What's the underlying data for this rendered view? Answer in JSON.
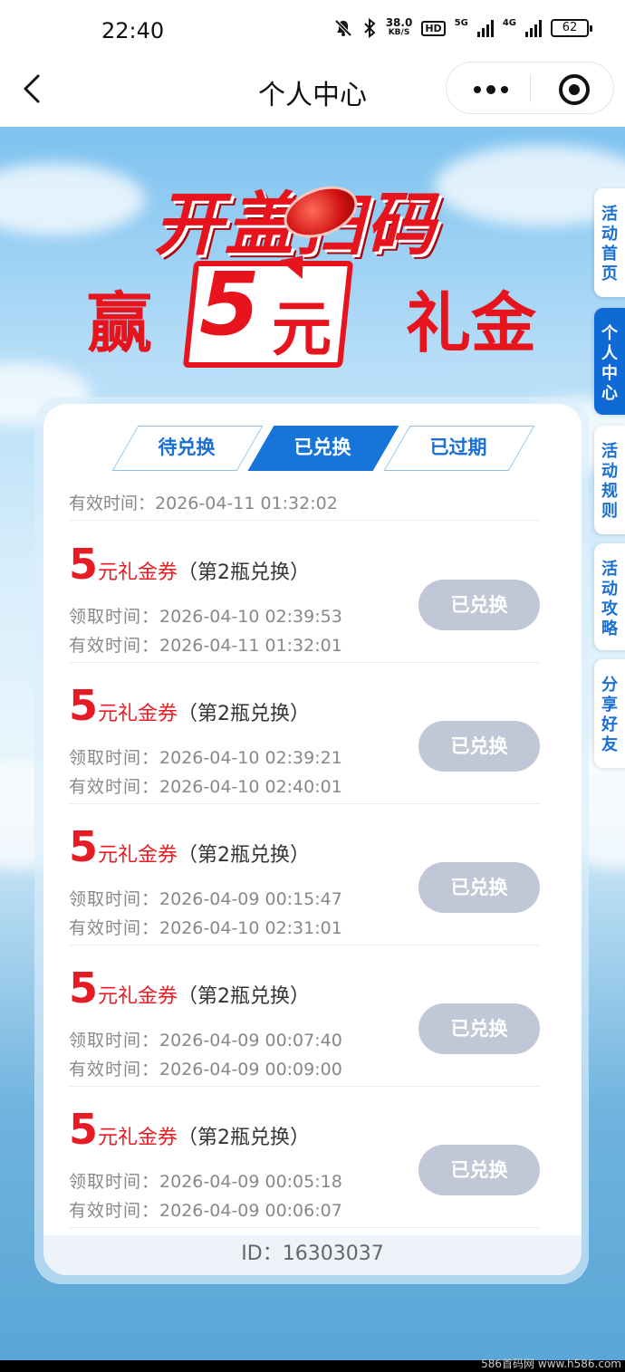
{
  "status_bar": {
    "time": "22:40",
    "net_speed_value": "38.0",
    "net_speed_unit": "KB/S",
    "hd_badge": "HD",
    "net1": "5G",
    "net2": "4G",
    "battery": "62"
  },
  "nav": {
    "title": "个人中心"
  },
  "banner": {
    "line1": "开盖扫码",
    "line2_left": "赢",
    "line2_amount": "5",
    "line2_unit": "元",
    "line2_right": "礼金"
  },
  "side_tabs": [
    {
      "label": "活动首页",
      "active": false
    },
    {
      "label": "个人中心",
      "active": true
    },
    {
      "label": "活动规则",
      "active": false
    },
    {
      "label": "活动攻略",
      "active": false
    },
    {
      "label": "分享好友",
      "active": false
    }
  ],
  "tabs": [
    {
      "label": "待兑换",
      "active": false
    },
    {
      "label": "已兑换",
      "active": true
    },
    {
      "label": "已过期",
      "active": false
    }
  ],
  "top_partial": {
    "valid_label": "有效时间：",
    "valid_time": "2026-04-11 01:32:02"
  },
  "labels": {
    "receive": "领取时间：",
    "valid": "有效时间："
  },
  "vouchers": [
    {
      "amount": "5",
      "unit": "元礼金券",
      "note": "（第2瓶兑换）",
      "receive_time": "2026-04-10 02:39:53",
      "valid_time": "2026-04-11 01:32:01",
      "status": "已兑换"
    },
    {
      "amount": "5",
      "unit": "元礼金券",
      "note": "（第2瓶兑换）",
      "receive_time": "2026-04-10 02:39:21",
      "valid_time": "2026-04-10 02:40:01",
      "status": "已兑换"
    },
    {
      "amount": "5",
      "unit": "元礼金券",
      "note": "（第2瓶兑换）",
      "receive_time": "2026-04-09 00:15:47",
      "valid_time": "2026-04-10 02:31:01",
      "status": "已兑换"
    },
    {
      "amount": "5",
      "unit": "元礼金券",
      "note": "（第2瓶兑换）",
      "receive_time": "2026-04-09 00:07:40",
      "valid_time": "2026-04-09 00:09:00",
      "status": "已兑换"
    },
    {
      "amount": "5",
      "unit": "元礼金券",
      "note": "（第2瓶兑换）",
      "receive_time": "2026-04-09 00:05:18",
      "valid_time": "2026-04-09 00:06:07",
      "status": "已兑换"
    }
  ],
  "footer": {
    "id_text": "ID：16303037"
  },
  "watermark": "586首码网 www.h586.com"
}
